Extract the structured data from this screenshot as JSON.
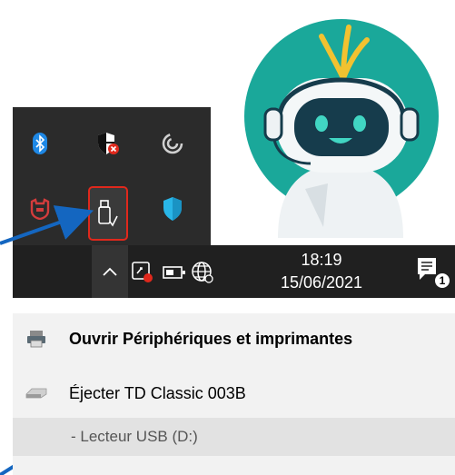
{
  "tray": {
    "icons": [
      {
        "name": "bluetooth-icon",
        "color": "#1e88e5"
      },
      {
        "name": "windows-security-icon",
        "color": "#e0281c"
      },
      {
        "name": "sync-icon",
        "color": "#d0d0d0"
      },
      {
        "name": "antivirus-shield-icon",
        "color": "#d43c3c"
      },
      {
        "name": "usb-eject-icon",
        "color": "#ffffff"
      },
      {
        "name": "defender-shield-icon",
        "color": "#29b6e8"
      }
    ],
    "highlight_color": "#e0281c"
  },
  "taskbar": {
    "time": "18:19",
    "date": "15/06/2021",
    "notification_count": "1"
  },
  "menu": {
    "items": [
      {
        "label": "Ouvrir Périphériques et imprimantes",
        "icon": "devices-printers-icon"
      },
      {
        "label": "Éjecter TD Classic 003B",
        "icon": "usb-drive-icon"
      },
      {
        "label": "- Lecteur USB (D:)",
        "icon": ""
      }
    ]
  },
  "colors": {
    "arrow": "#1466c0",
    "bot_circle": "#1aa89a",
    "bot_body": "#eef2f4",
    "taskbar": "#202020",
    "tray": "#2b2b2b",
    "menu": "#f2f2f2"
  }
}
